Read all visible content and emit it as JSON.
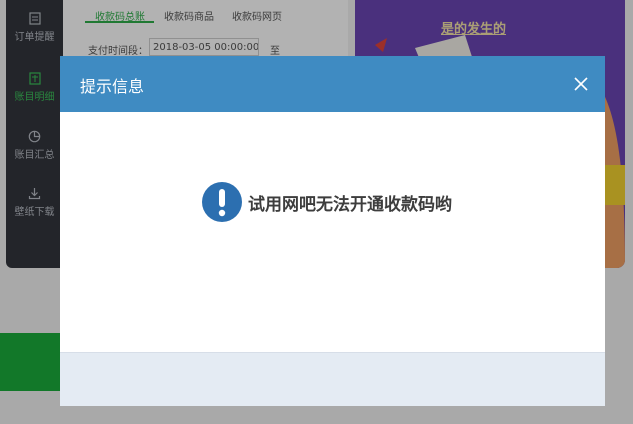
{
  "sidebar": {
    "items": [
      {
        "label": "订单提醒",
        "icon": "order-doc-icon",
        "active": false
      },
      {
        "label": "账目明细",
        "icon": "ledger-icon",
        "active": true
      },
      {
        "label": "账目汇总",
        "icon": "pie-chart-icon",
        "active": false
      },
      {
        "label": "壁纸下载",
        "icon": "download-icon",
        "active": false
      }
    ]
  },
  "content": {
    "tabs": [
      {
        "label": "收款码总账",
        "active": true
      },
      {
        "label": "收款码商品",
        "active": false
      },
      {
        "label": "收款码网页",
        "active": false
      }
    ],
    "filter": {
      "label": "支付时间段：",
      "start_value": "2018-03-05 00:00:00",
      "extra": "至"
    }
  },
  "promo": {
    "title": "是的发生的"
  },
  "modal": {
    "title": "提示信息",
    "message": "试用网吧无法开通收款码哟",
    "icon": "exclamation-icon",
    "close_icon": "close-icon"
  },
  "colors": {
    "header": "#3f8bc2",
    "accent_green": "#2fae4a",
    "info_icon": "#2c6fb0",
    "footer": "#e4ebf3",
    "sidebar": "#33363d",
    "promo": "#6a45b4"
  }
}
